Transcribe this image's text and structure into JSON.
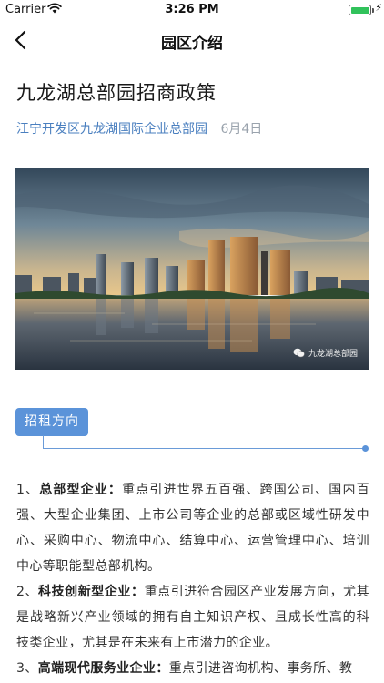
{
  "status_bar": {
    "carrier": "Carrier",
    "time": "3:26 PM",
    "battery_level": 1.0
  },
  "nav": {
    "title": "园区介绍",
    "back_icon": "chevron-left-icon"
  },
  "article": {
    "title": "九龙湖总部园招商政策",
    "source": "江宁开发区九龙湖国际企业总部园",
    "date": "6月4日",
    "image": {
      "watermark": "九龙湖总部园",
      "watermark_icon": "wechat-icon"
    }
  },
  "section": {
    "tag_label": "招租方向"
  },
  "policies": [
    {
      "index": "1、",
      "label": "总部型企业：",
      "text": "重点引进世界五百强、跨国公司、国内百强、大型企业集团、上市公司等企业的总部或区域性研发中心、采购中心、物流中心、结算中心、运营管理中心、培训中心等职能型总部机构。"
    },
    {
      "index": "2、",
      "label": "科技创新型企业：",
      "text": "重点引进符合园区产业发展方向，尤其是战略新兴产业领域的拥有自主知识产权、且成长性高的科技类企业，尤其是在未来有上市潜力的企业。"
    },
    {
      "index": "3、",
      "label": "高端现代服务业企业：",
      "text": "重点引进咨询机构、事务所、教"
    }
  ],
  "colors": {
    "accent": "#5b93d9",
    "source_text": "#4a7fbf",
    "date_text": "#9aa3ad"
  }
}
